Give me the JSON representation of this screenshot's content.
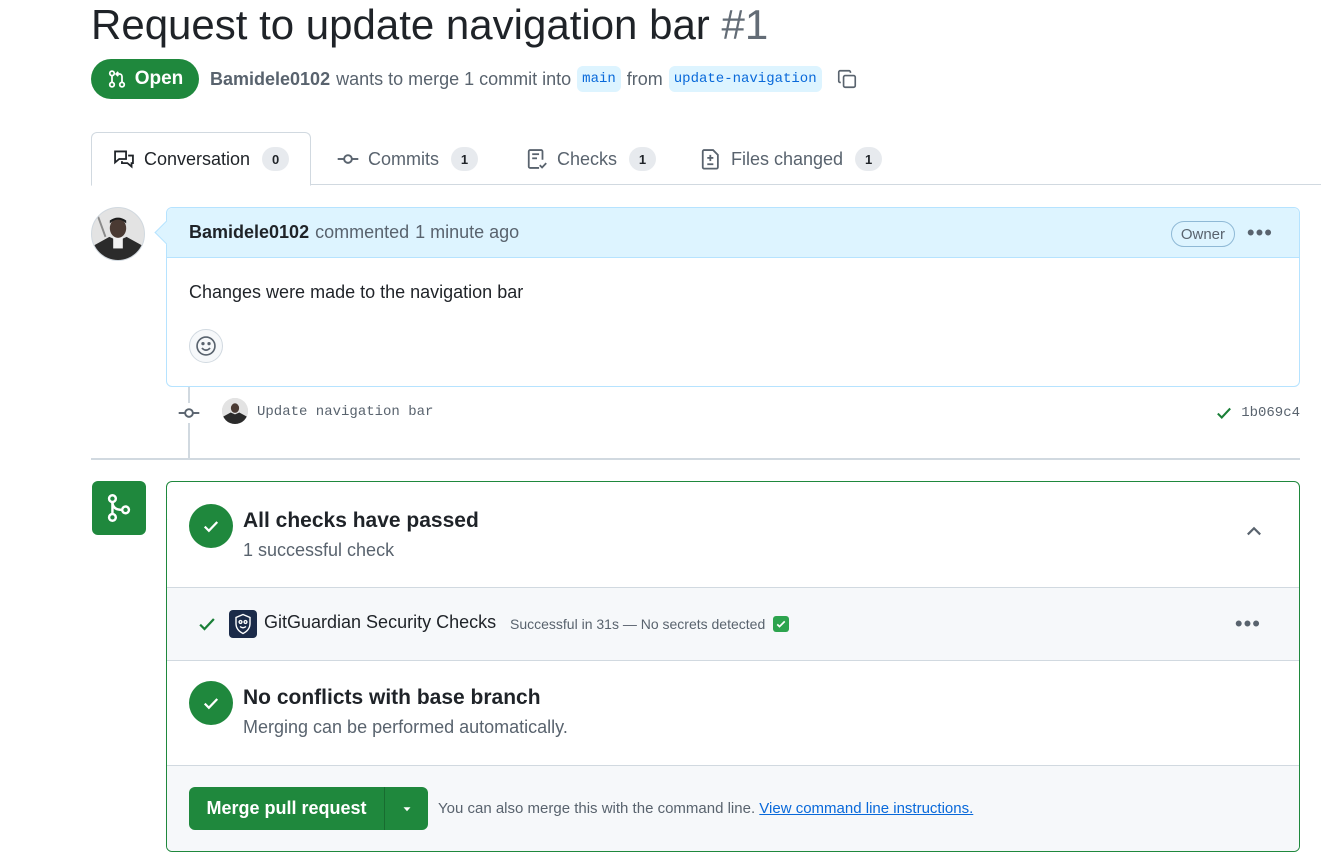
{
  "pr": {
    "title": "Request to update navigation bar",
    "number": "#1",
    "state": "Open",
    "author": "Bamidele0102",
    "merge_text": "wants to merge 1 commit into",
    "base_branch": "main",
    "from_text": "from",
    "head_branch": "update-navigation"
  },
  "tabs": [
    {
      "label": "Conversation",
      "count": "0",
      "icon": "comment-discussion-icon"
    },
    {
      "label": "Commits",
      "count": "1",
      "icon": "git-commit-icon"
    },
    {
      "label": "Checks",
      "count": "1",
      "icon": "checklist-icon"
    },
    {
      "label": "Files changed",
      "count": "1",
      "icon": "file-diff-icon"
    }
  ],
  "comment": {
    "author": "Bamidele0102",
    "action": "commented",
    "time": "1 minute ago",
    "role": "Owner",
    "body": "Changes were made to the navigation bar"
  },
  "commit": {
    "message": "Update navigation bar",
    "sha": "1b069c4"
  },
  "checks": {
    "title": "All checks have passed",
    "subtitle": "1 successful check",
    "item_name": "GitGuardian Security Checks",
    "item_status": "Successful in 31s — No secrets detected"
  },
  "conflicts": {
    "title": "No conflicts with base branch",
    "subtitle": "Merging can be performed automatically."
  },
  "merge": {
    "button_label": "Merge pull request",
    "note": "You can also merge this with the command line.",
    "link_text": "View command line instructions."
  },
  "colors": {
    "success": "#1f883d",
    "accent": "#0969da",
    "comment_header": "#ddf4ff"
  }
}
